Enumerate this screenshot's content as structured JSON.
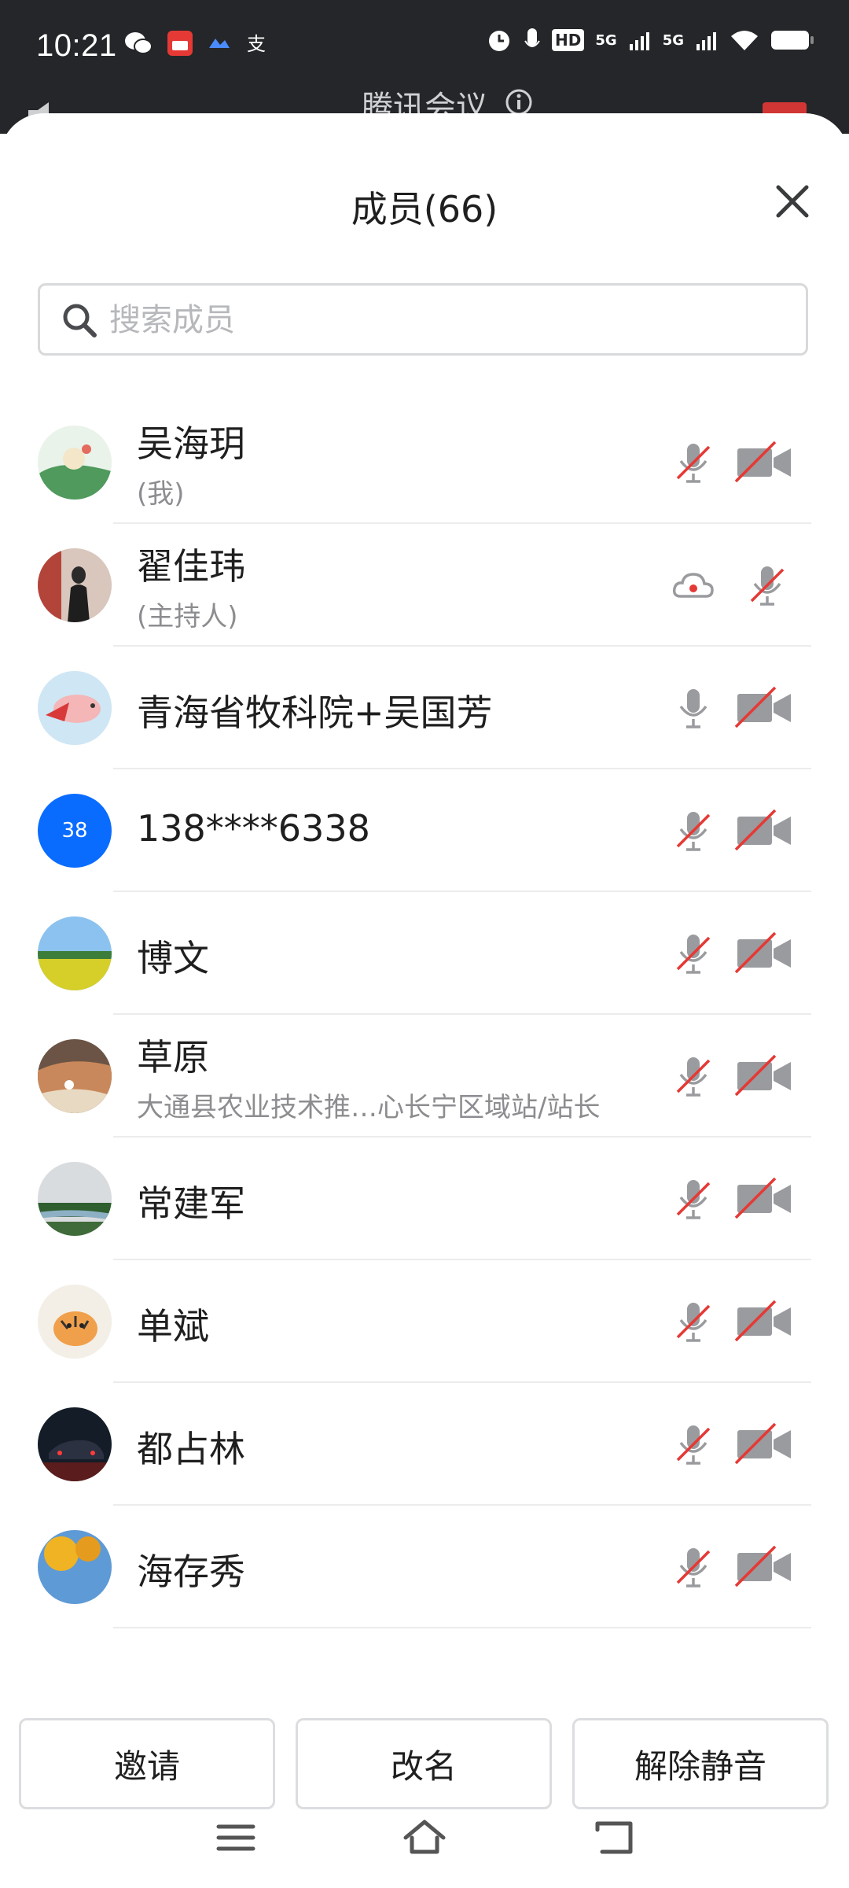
{
  "status": {
    "time": "10:21",
    "network": "5G",
    "hd_label": "HD"
  },
  "background": {
    "meeting_title": "腾讯会议"
  },
  "sheet": {
    "title": "成员(66)"
  },
  "search": {
    "placeholder": "搜索成员",
    "value": ""
  },
  "members": [
    {
      "name": "吴海玥",
      "sub": "(我)",
      "avatar": "landscape-green",
      "icon1": "mic-muted-icon",
      "icon2": "camera-off-icon"
    },
    {
      "name": "翟佳玮",
      "sub": "(主持人)",
      "avatar": "photo-person",
      "icon1": "cloud-record-icon",
      "icon2": "mic-muted-icon"
    },
    {
      "name": "青海省牧科院+吴国芳",
      "sub": "",
      "avatar": "pig-cartoon",
      "icon1": "mic-icon",
      "icon2": "camera-off-icon"
    },
    {
      "name": "138****6338",
      "sub": "",
      "avatar": "initials",
      "avatar_text": "38",
      "icon1": "mic-muted-icon",
      "icon2": "camera-off-icon"
    },
    {
      "name": "博文",
      "sub": "",
      "avatar": "field",
      "icon1": "mic-muted-icon",
      "icon2": "camera-off-icon"
    },
    {
      "name": "草原",
      "sub": "大通县农业技术推…心长宁区域站/站长",
      "avatar": "desert",
      "icon1": "mic-muted-icon",
      "icon2": "camera-off-icon"
    },
    {
      "name": "常建军",
      "sub": "",
      "avatar": "river",
      "icon1": "mic-muted-icon",
      "icon2": "camera-off-icon"
    },
    {
      "name": "单斌",
      "sub": "",
      "avatar": "tiger",
      "icon1": "mic-muted-icon",
      "icon2": "camera-off-icon"
    },
    {
      "name": "都占林",
      "sub": "",
      "avatar": "car-night",
      "icon1": "mic-muted-icon",
      "icon2": "camera-off-icon"
    },
    {
      "name": "海存秀",
      "sub": "",
      "avatar": "autumn",
      "icon1": "mic-muted-icon",
      "icon2": "camera-off-icon"
    }
  ],
  "buttons": {
    "invite": "邀请",
    "rename": "改名",
    "unmute_all": "解除静音"
  },
  "colors": {
    "accent_blue": "#0a6cff",
    "mute_red": "#e53935",
    "icon_gray": "#9a9b9e",
    "record_red": "#e53935"
  }
}
